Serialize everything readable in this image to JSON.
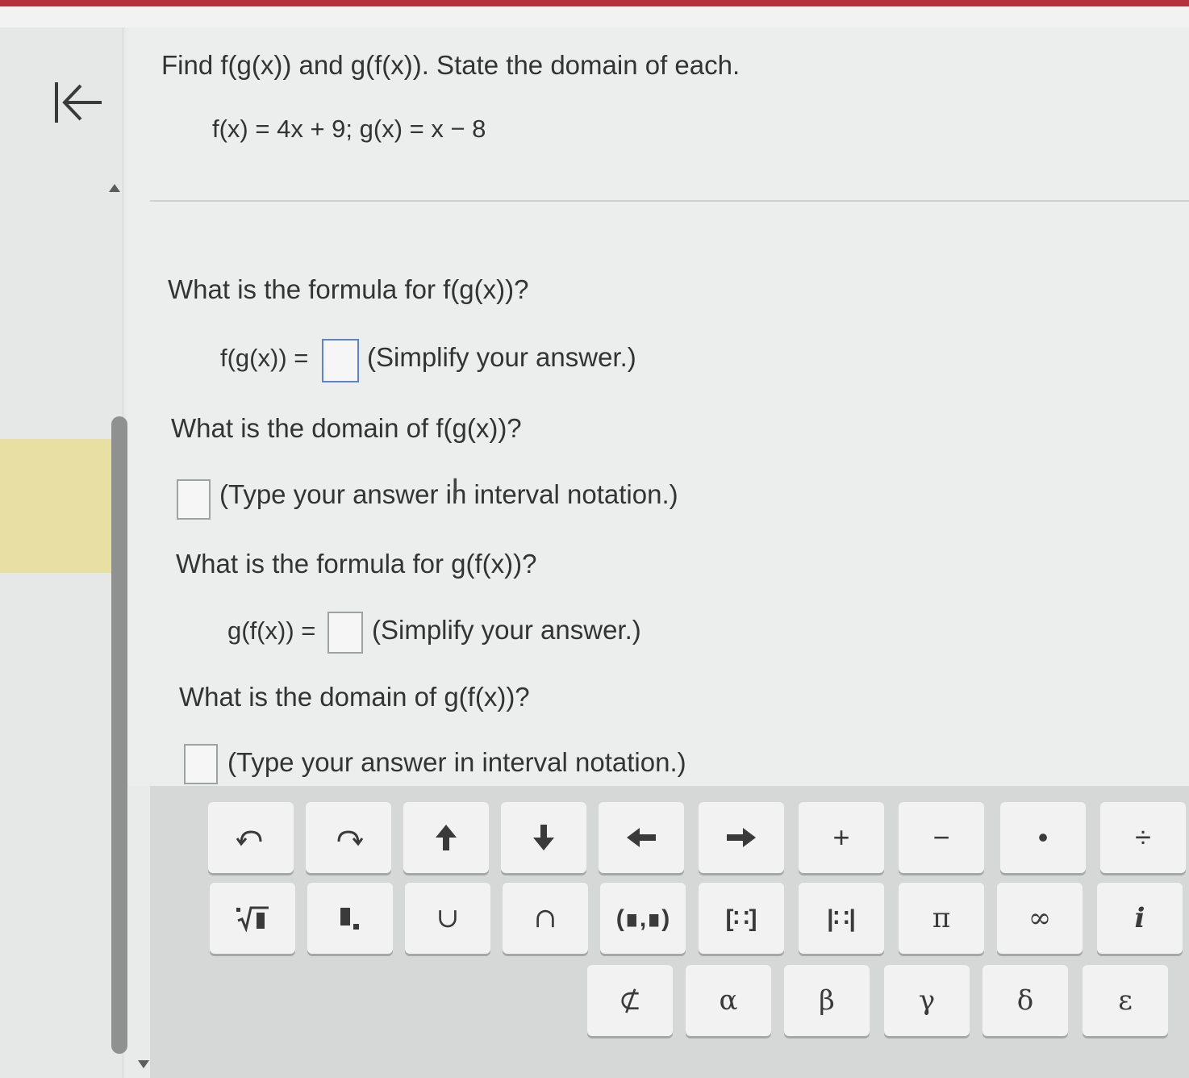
{
  "question": {
    "prompt": "Find f(g(x)) and g(f(x)). State the domain of each.",
    "given": "f(x) = 4x + 9; g(x) = x − 8"
  },
  "parts": {
    "q1": "What is the formula for f(g(x))?",
    "a1_label": "f(g(x)) =",
    "a1_hint": "(Simplify your answer.)",
    "q2": "What is the domain of f(g(x))?",
    "a2_hint": "(Type your answer in interval notation.)",
    "q3": "What is the formula for g(f(x))?",
    "a3_label": "g(f(x)) =",
    "a3_hint": "(Simplify your answer.)",
    "q4": "What is the domain of g(f(x))?",
    "a4_hint": "(Type your answer in interval notation.)"
  },
  "keypad": {
    "row1": [
      "undo-icon",
      "redo-icon",
      "up-arrow-icon",
      "down-arrow-icon",
      "left-arrow-icon",
      "right-arrow-icon",
      "+",
      "−",
      "•",
      "÷"
    ],
    "row2": [
      "nth-root-icon",
      "subscript-icon",
      "∪",
      "∩",
      "(∎,∎)",
      "[∷]",
      "|∷|",
      "π",
      "∞",
      "i"
    ],
    "row3": [
      "⊄",
      "α",
      "β",
      "γ",
      "δ",
      "ε"
    ]
  },
  "colors": {
    "accent": "#b5323d",
    "highlight": "#e8e0a3",
    "active_box": "#5b84c9"
  }
}
